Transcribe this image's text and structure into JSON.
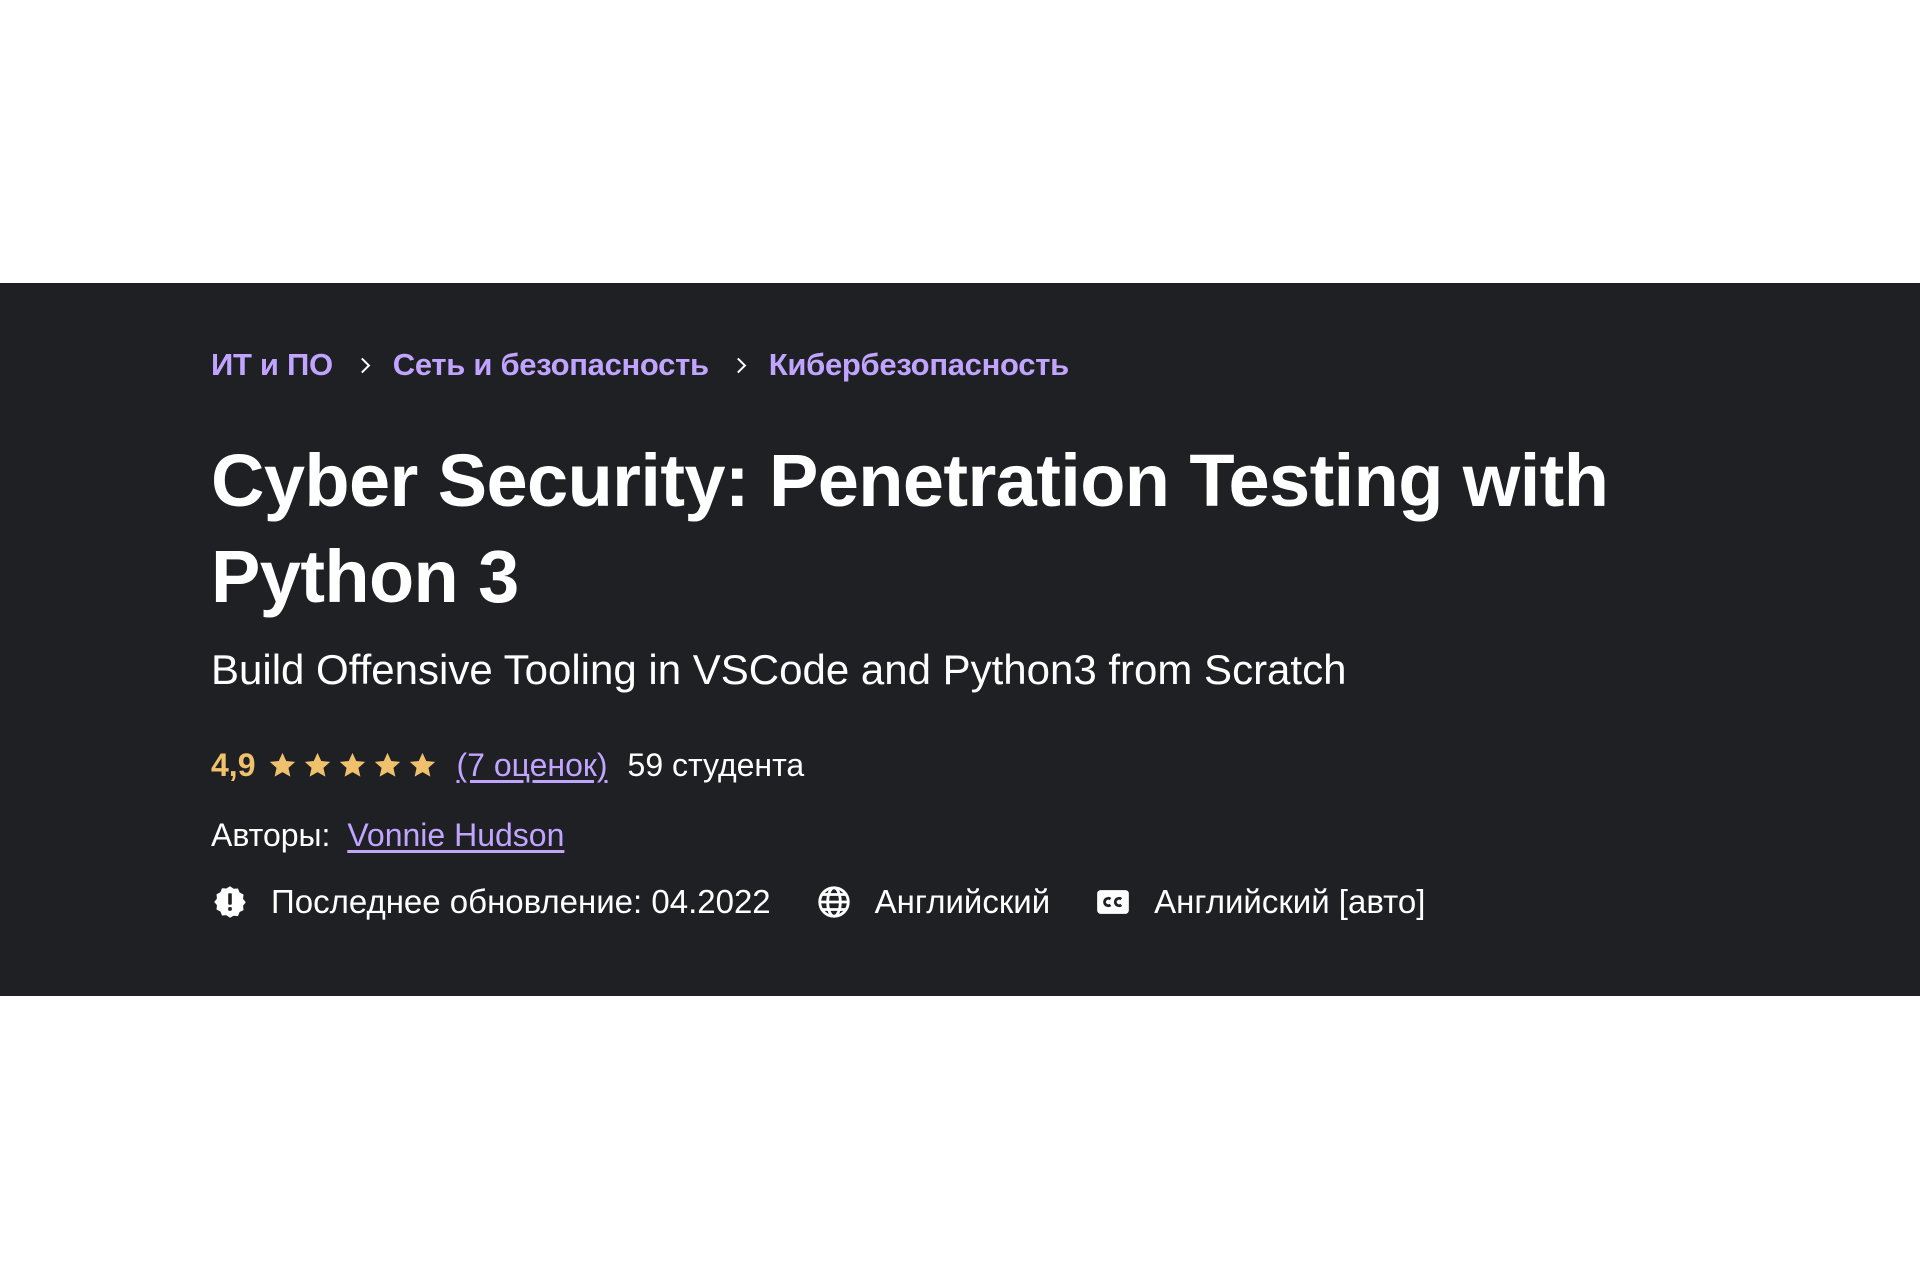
{
  "breadcrumb": [
    {
      "label": "ИТ и ПО"
    },
    {
      "label": "Сеть и безопасность"
    },
    {
      "label": "Кибербезопасность"
    }
  ],
  "course": {
    "title": "Cyber Security: Penetration Testing with Python 3",
    "subtitle": "Build Offensive Tooling in VSCode and Python3 from Scratch",
    "rating": "4,9",
    "rating_stars": 5,
    "ratings_count_label": "(7 оценок)",
    "students_label": "59 студента",
    "authors_label": "Авторы:",
    "author_name": "Vonnie Hudson",
    "last_updated_label": "Последнее обновление: 04.2022",
    "language": "Английский",
    "captions": "Английский [авто]"
  },
  "icons": {
    "updated": "alert-badge-icon",
    "language": "globe-icon",
    "captions": "closed-captions-icon",
    "star": "star-icon",
    "separator": "chevron-right-icon"
  },
  "colors": {
    "banner_bg": "#1f2023",
    "link": "#c0a4ff",
    "rating": "#f0c16c",
    "text": "#ffffff"
  }
}
